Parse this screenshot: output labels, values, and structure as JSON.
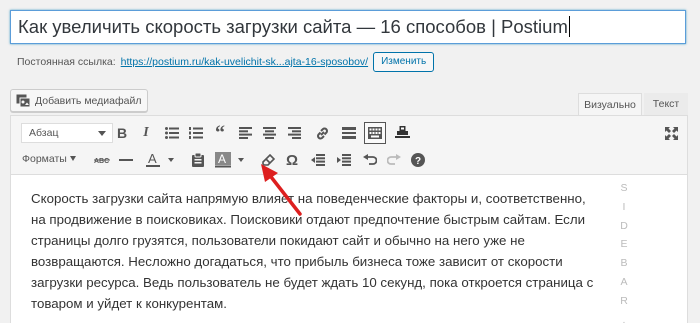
{
  "title": {
    "value": "Как увеличить скорость загрузки сайта — 16 способов | Postium"
  },
  "permalink": {
    "label": "Постоянная ссылка:",
    "url": "https://postium.ru/kak-uvelichit-sk...ajta-16-sposobov/",
    "change_label": "Изменить"
  },
  "media_button": {
    "label": "Добавить медиафайл"
  },
  "tabs": {
    "visual": "Визуально",
    "text": "Текст"
  },
  "toolbar": {
    "format_select": "Абзац",
    "formats_label": "Форматы",
    "row1_icons": [
      "bold-icon",
      "italic-icon",
      "bullet-list-icon",
      "numbered-list-icon",
      "blockquote-icon",
      "align-left-icon",
      "align-center-icon",
      "align-right-icon",
      "link-icon",
      "read-more-icon",
      "toolbar-toggle-icon",
      "custom-stamp-icon",
      "fullscreen-icon"
    ],
    "row2_icons": [
      "strikethrough-icon",
      "horizontal-line-icon",
      "text-color-icon",
      "paste-as-text-icon",
      "background-color-icon",
      "clear-formatting-icon",
      "special-character-icon",
      "outdent-icon",
      "indent-icon",
      "undo-icon",
      "redo-icon",
      "help-icon"
    ]
  },
  "content": {
    "paragraph": "Скорость загрузки сайта напрямую влияет на поведенческие факторы и, соответственно, на продвижение в поисковиках. Поисковики отдают предпочтение быстрым сайтам. Если страницы долго грузятся, пользователи покидают сайт и обычно на него уже не возвращаются. Несложно догадаться, что прибыль бизнеса тоже зависит от скорости загрузки ресурса. Ведь пользователь не будет ждать 10 секунд, пока откроется страница с товаром и уйдет к конкурентам."
  },
  "sidebar_letters": [
    "S",
    "I",
    "D",
    "E",
    "B",
    "A",
    "R",
    "."
  ],
  "colors": {
    "accent": "#0073aa",
    "arrow": "#dd1f1f",
    "focus": "#5b9dd9"
  }
}
